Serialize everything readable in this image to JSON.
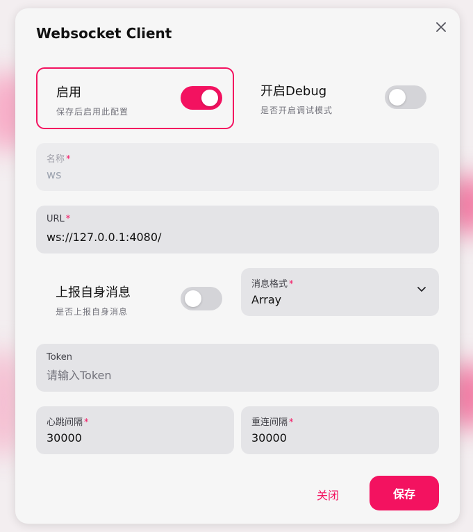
{
  "dialog": {
    "title": "Websocket Client",
    "close_icon": "close-icon"
  },
  "enable": {
    "label": "启用",
    "description": "保存后启用此配置",
    "checked": true
  },
  "debug": {
    "label": "开启Debug",
    "description": "是否开启调试模式",
    "checked": false
  },
  "name_field": {
    "label": "名称",
    "value": "ws"
  },
  "url_field": {
    "label": "URL",
    "value": "ws://127.0.0.1:4080/"
  },
  "report_self": {
    "label": "上报自身消息",
    "description": "是否上报自身消息",
    "checked": false
  },
  "message_format": {
    "label": "消息格式",
    "value": "Array"
  },
  "token_field": {
    "label": "Token",
    "placeholder": "请输入Token"
  },
  "heartbeat_field": {
    "label": "心跳间隔",
    "value": "30000"
  },
  "reconnect_field": {
    "label": "重连间隔",
    "value": "30000"
  },
  "actions": {
    "close_label": "关闭",
    "save_label": "保存"
  },
  "colors": {
    "accent": "#f31260",
    "field_bg": "#e4e4e7"
  },
  "required_mark": "*"
}
